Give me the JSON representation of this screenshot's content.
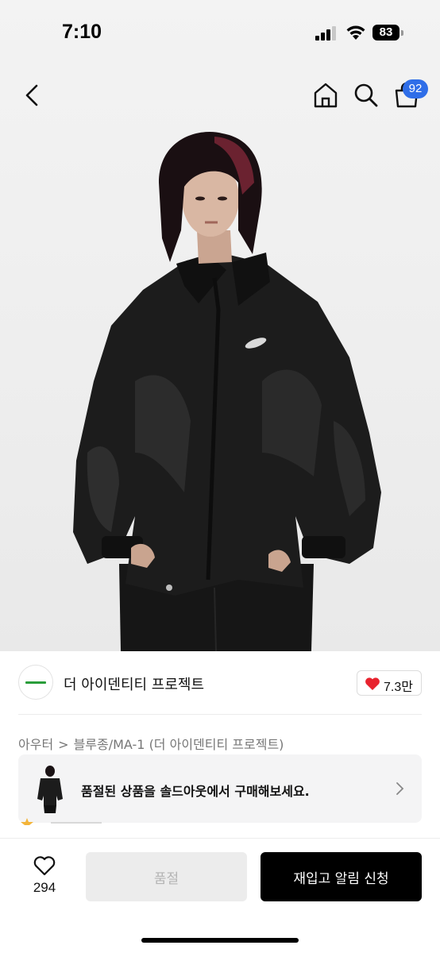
{
  "status_bar": {
    "time": "7:10",
    "battery": "83"
  },
  "nav": {
    "icons": [
      "back-icon",
      "home-icon",
      "search-icon",
      "bag-icon"
    ],
    "cart_count": "92"
  },
  "brand": {
    "name": "더 아이덴티티 프로젝트",
    "likes": "7.3만"
  },
  "breadcrumb": {
    "category": "아우터",
    "separator": ">",
    "subcategory": "블루종/MA-1 (더 아이덴티티 프로젝트)"
  },
  "promo": {
    "text": "품절된 상품을 솔드아웃에서 구매해보세요."
  },
  "bottom_bar": {
    "wish_count": "294",
    "soldout_label": "품절",
    "restock_label": "재입고 알림 신청"
  },
  "colors": {
    "accent_badge": "#2f6ee8",
    "heart": "#e8232e",
    "primary_button": "#000000",
    "disabled_button": "#ececec"
  }
}
